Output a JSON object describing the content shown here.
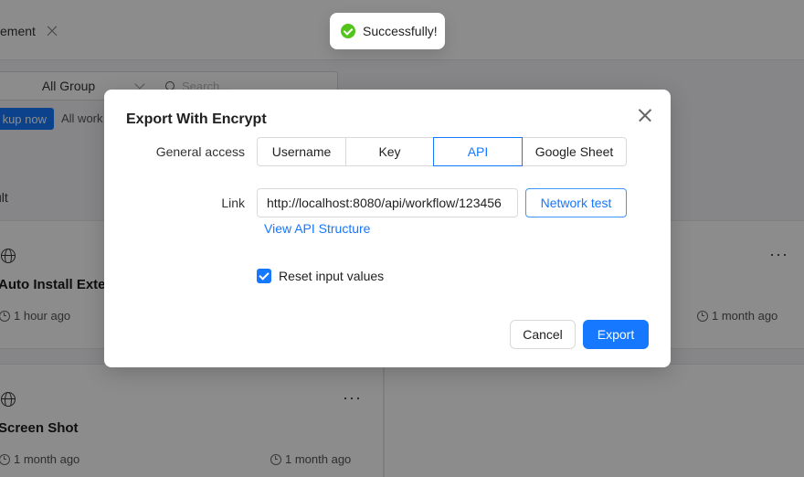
{
  "background": {
    "tab": {
      "label": "ement"
    },
    "filters": {
      "group_select": "All Group",
      "search_placeholder": "Search..."
    },
    "backup_button": "kup now",
    "all_workflows": "All work",
    "result_label": "ult",
    "cards": [
      {
        "title": "Auto Install Exter",
        "created": "1 hour ago",
        "updated": ""
      },
      {
        "title": "",
        "created": "",
        "updated": "1 month ago"
      },
      {
        "title": "Screen Shot",
        "created": "1 month ago",
        "updated": "1 month ago"
      },
      {
        "title": "",
        "created": "",
        "updated": ""
      }
    ],
    "more_glyph": "···"
  },
  "toast": {
    "message": "Successfully!",
    "color": "#52c41a"
  },
  "modal": {
    "title": "Export With Encrypt",
    "general_access_label": "General access",
    "access_options": [
      "Username",
      "Key",
      "API",
      "Google Sheet"
    ],
    "selected_option": "API",
    "link_label": "Link",
    "link_value": "http://localhost:8080/api/workflow/123456",
    "network_test_button": "Network test",
    "view_api_link": "View API Structure",
    "reset_checkbox_label": "Reset input values",
    "reset_checked": true,
    "cancel_button": "Cancel",
    "export_button": "Export",
    "accent_color": "#1677ff"
  }
}
